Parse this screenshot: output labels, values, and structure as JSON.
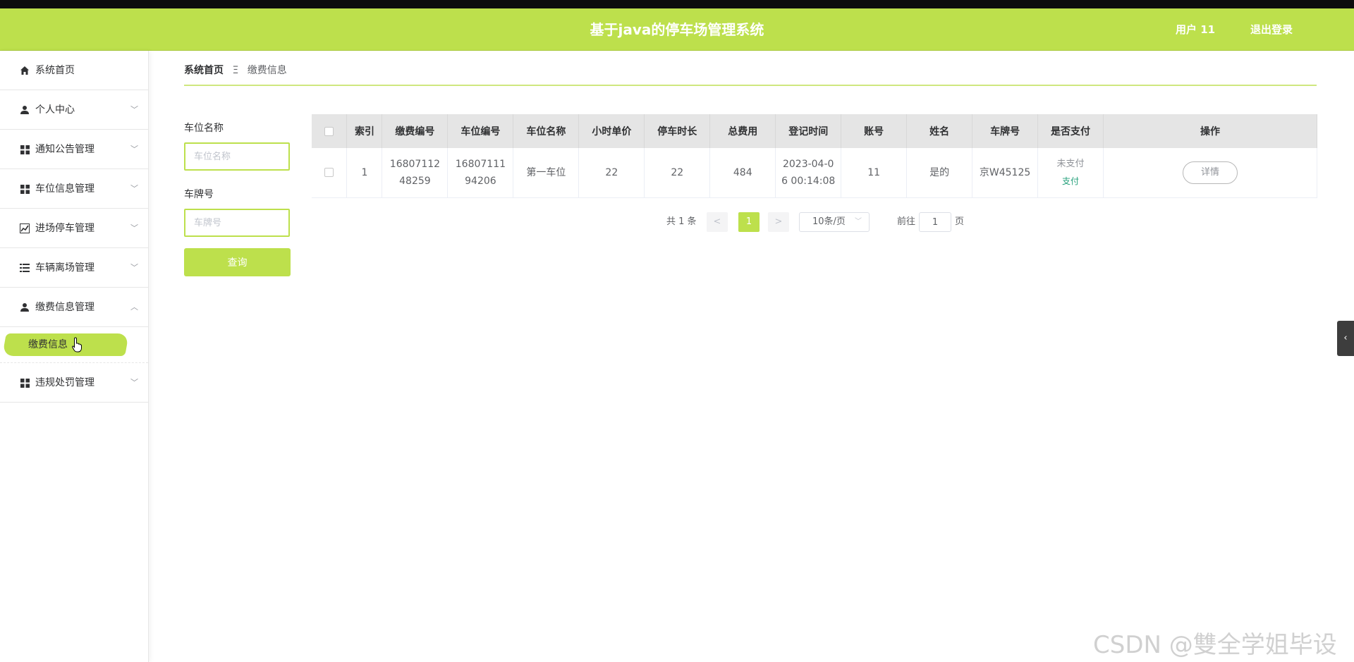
{
  "header": {
    "title": "基于java的停车场管理系统",
    "user": "用户 11",
    "logout": "退出登录"
  },
  "sidebar": {
    "items": [
      {
        "label": "系统首页",
        "icon": "home-icon"
      },
      {
        "label": "个人中心",
        "icon": "user-icon"
      },
      {
        "label": "通知公告管理",
        "icon": "grid-icon"
      },
      {
        "label": "车位信息管理",
        "icon": "grid-icon"
      },
      {
        "label": "进场停车管理",
        "icon": "chart-icon"
      },
      {
        "label": "车辆离场管理",
        "icon": "list-icon"
      },
      {
        "label": "缴费信息管理",
        "icon": "user-icon"
      },
      {
        "label": "违规处罚管理",
        "icon": "grid-icon"
      }
    ],
    "subitem": "缴费信息"
  },
  "breadcrumb": {
    "home": "系统首页",
    "sep": "Ξ",
    "current": "缴费信息"
  },
  "filters": {
    "space_name_label": "车位名称",
    "space_name_placeholder": "车位名称",
    "plate_label": "车牌号",
    "plate_placeholder": "车牌号",
    "query": "查询"
  },
  "table": {
    "headers": [
      "索引",
      "缴费编号",
      "车位编号",
      "车位名称",
      "小时单价",
      "停车时长",
      "总费用",
      "登记时间",
      "账号",
      "姓名",
      "车牌号",
      "是否支付",
      "操作"
    ],
    "rows": [
      {
        "index": "1",
        "pay_no": "1680711248259",
        "space_no": "1680711194206",
        "space_name": "第一车位",
        "hour_price": "22",
        "duration": "22",
        "total": "484",
        "reg_time": "2023-04-06 00:14:08",
        "account": "11",
        "name": "是的",
        "plate": "京W45125",
        "paid_status": "未支付",
        "pay_action": "支付",
        "detail": "详情"
      }
    ]
  },
  "pagination": {
    "total": "共 1 条",
    "prev": "<",
    "page": "1",
    "next": ">",
    "size": "10条/页",
    "goto": "前往",
    "goto_value": "1",
    "unit": "页"
  },
  "watermark": "CSDN @雙全学姐毕设",
  "colors": {
    "accent": "#bde04c",
    "pay_link": "#23a07a"
  }
}
